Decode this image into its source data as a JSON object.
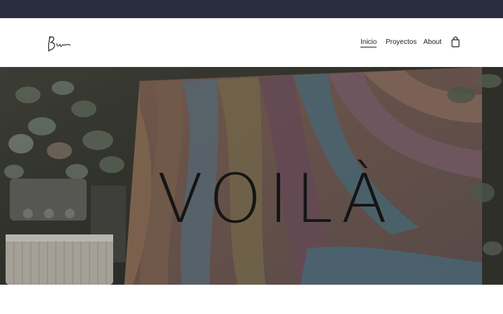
{
  "site": {
    "logo_text": "Bam"
  },
  "nav": {
    "items": [
      {
        "label": "Inicio",
        "active": true
      },
      {
        "label": "Proyectos",
        "active": false
      },
      {
        "label": "About",
        "active": false
      }
    ],
    "cart_icon": "shopping-bag-icon"
  },
  "hero": {
    "image_text": "VOILÀ"
  },
  "colors": {
    "topbar": "#2a2d3d",
    "background": "#ffffff",
    "text": "#222222"
  }
}
